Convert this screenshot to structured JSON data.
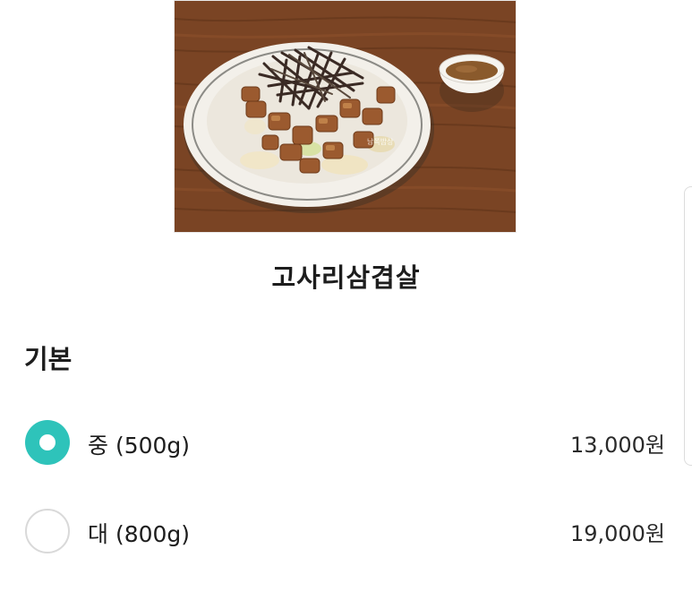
{
  "menu": {
    "title": "고사리삼겹살",
    "image": {
      "alt": "고사리삼겹살 사진",
      "watermark": "남쪽밥상"
    }
  },
  "options_section": {
    "title": "기본",
    "options": [
      {
        "label": "중 (500g)",
        "price": "13,000원",
        "selected": true
      },
      {
        "label": "대 (800g)",
        "price": "19,000원",
        "selected": false
      }
    ]
  },
  "colors": {
    "accent": "#2ec3ba",
    "radio_border": "#d9d9d9",
    "text": "#1d1d1d"
  }
}
